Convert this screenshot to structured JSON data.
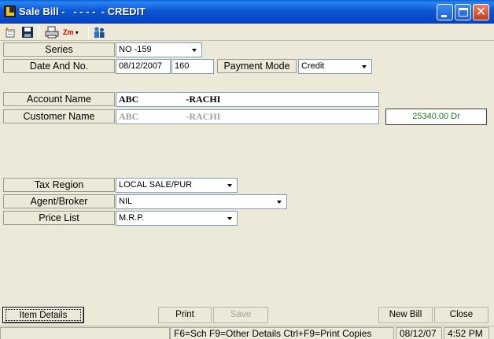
{
  "window": {
    "title": "Sale Bill -   - - - -  - CREDIT",
    "minimize_label": "",
    "maximize_label": "",
    "close_glyph": "✕"
  },
  "toolbar": {
    "items": [
      "new-icon",
      "save-icon",
      "print-preview-icon",
      "zoom-icon",
      "users-icon"
    ],
    "zoom_label": "Zm"
  },
  "form": {
    "series": {
      "label": "Series",
      "value": "NO  -159"
    },
    "date_no": {
      "label": "Date And No.",
      "date": "08/12/2007",
      "number": "160"
    },
    "payment_mode": {
      "label": "Payment Mode",
      "value": "Credit"
    },
    "account_name": {
      "label": "Account Name",
      "value": "ABC                    -RACHI"
    },
    "customer_name": {
      "label": "Customer Name",
      "value": "ABC                    -RACHI"
    },
    "balance": "25340.00 Dr",
    "tax_region": {
      "label": "Tax Region",
      "value": "LOCAL SALE/PUR"
    },
    "agent_broker": {
      "label": "Agent/Broker",
      "value": "NIL"
    },
    "price_list": {
      "label": "Price List",
      "value": "M.R.P."
    }
  },
  "buttons": {
    "item_details": "Item Details",
    "print": "Print",
    "save": "Save",
    "new_bill": "New Bill",
    "close": "Close"
  },
  "statusbar": {
    "hints": "F6=Sch F9=Other Details Ctrl+F9=Print Copies",
    "date": "08/12/07",
    "time": "4:52 PM"
  },
  "colors": {
    "titlebar": "#0b57d4",
    "balance_text": "#1f7a1f",
    "window_bg": "#ece9d8"
  }
}
